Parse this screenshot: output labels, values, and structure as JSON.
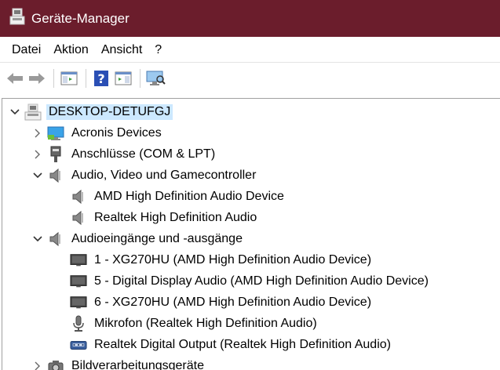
{
  "window": {
    "title": "Geräte-Manager"
  },
  "menu": [
    "Datei",
    "Aktion",
    "Ansicht",
    "?"
  ],
  "tree": {
    "root": "DESKTOP-DETUFGJ",
    "rows": [
      {
        "label": "Acronis Devices",
        "icon": "monitor-icon",
        "expanded": false
      },
      {
        "label": "Anschlüsse (COM & LPT)",
        "icon": "port-icon",
        "expanded": false
      },
      {
        "label": "Audio, Video und Gamecontroller",
        "icon": "speaker-icon",
        "expanded": true
      },
      {
        "label": "AMD High Definition Audio Device",
        "icon": "speaker-icon",
        "child": true
      },
      {
        "label": "Realtek High Definition Audio",
        "icon": "speaker-icon",
        "child": true
      },
      {
        "label": "Audioeingänge und -ausgänge",
        "icon": "speaker-icon",
        "expanded": true
      },
      {
        "label": "1 - XG270HU (AMD High Definition Audio Device)",
        "icon": "display-icon",
        "child": true
      },
      {
        "label": "5 - Digital Display Audio (AMD High Definition Audio Device)",
        "icon": "display-icon",
        "child": true
      },
      {
        "label": "6 - XG270HU (AMD High Definition Audio Device)",
        "icon": "display-icon",
        "child": true
      },
      {
        "label": "Mikrofon (Realtek High Definition Audio)",
        "icon": "microphone-icon",
        "child": true
      },
      {
        "label": "Realtek Digital Output (Realtek High Definition Audio)",
        "icon": "digital-output-icon",
        "child": true
      },
      {
        "label": "Bildverarbeitungsgeräte",
        "icon": "camera-icon",
        "expanded": false
      }
    ]
  },
  "colors": {
    "titlebar": "#6b1d2c",
    "selection": "#cce8ff"
  }
}
